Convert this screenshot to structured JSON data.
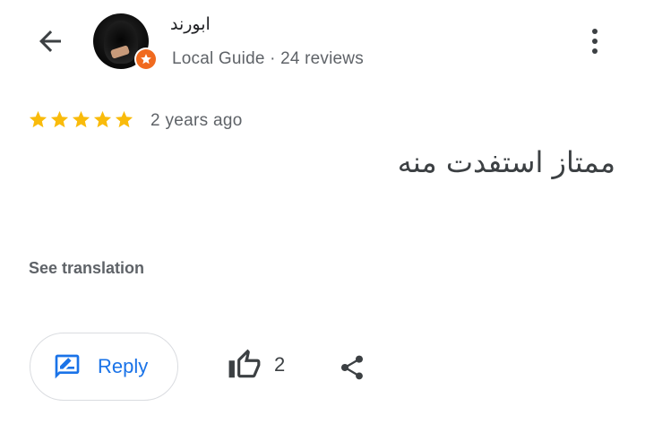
{
  "header": {
    "author_name": "ابورند",
    "author_meta": "Local Guide · 24 reviews"
  },
  "review": {
    "rating": 5,
    "max_rating": 5,
    "date": "2 years ago",
    "text": "ممتاز استفدت منه",
    "see_translation_label": "See translation"
  },
  "actions": {
    "reply_label": "Reply",
    "like_count": "2"
  },
  "icons": {
    "back": "arrow-back-icon",
    "more": "more-vert-icon",
    "star": "star-icon",
    "reply": "rate-review-icon",
    "like": "thumb-up-icon",
    "share": "share-icon",
    "local_guide_badge": "local-guide-badge-icon"
  },
  "colors": {
    "star": "#f9bb0b",
    "accent_blue": "#1a73e8",
    "local_guide_orange": "#f06a1f",
    "secondary_text": "#5f6368"
  }
}
